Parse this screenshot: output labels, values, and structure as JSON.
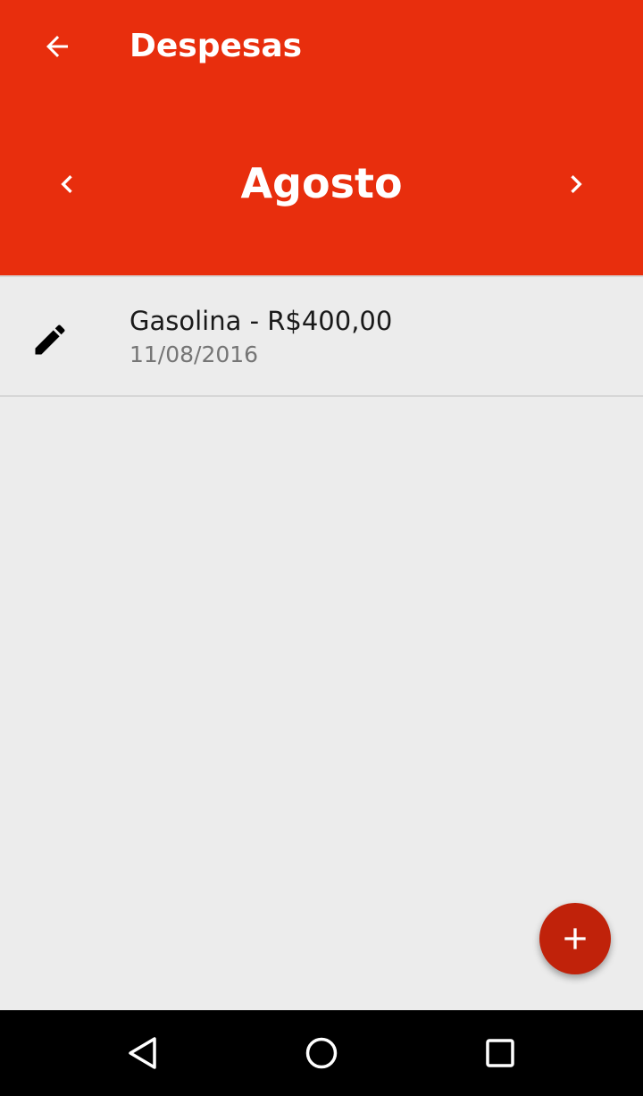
{
  "app_bar": {
    "title": "Despesas",
    "back_icon": "arrow-back-icon",
    "color": "#e82e0d"
  },
  "month_selector": {
    "month": "Agosto",
    "prev_icon": "chevron-left-icon",
    "next_icon": "chevron-right-icon"
  },
  "expenses": [
    {
      "title": "Gasolina - R$400,00",
      "date": "11/08/2016",
      "icon": "pencil-icon"
    }
  ],
  "fab": {
    "icon": "plus-icon",
    "color": "#c0220a"
  },
  "nav_bar": {
    "back_icon": "nav-back-icon",
    "home_icon": "nav-home-icon",
    "recents_icon": "nav-recents-icon"
  }
}
